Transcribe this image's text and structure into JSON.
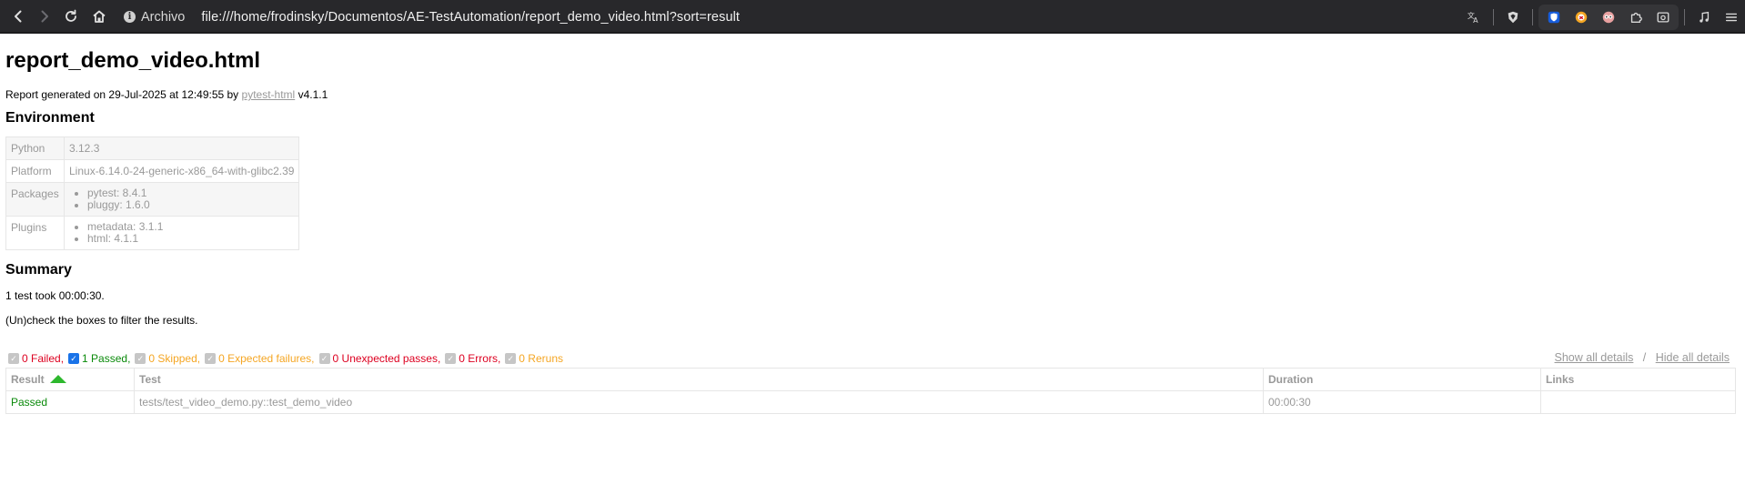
{
  "browser": {
    "site_label": "Archivo",
    "url": "file:///home/frodinsky/Documentos/AE-TestAutomation/report_demo_video.html?sort=result"
  },
  "report": {
    "title": "report_demo_video.html",
    "generated_prefix": "Report generated on 29-Jul-2025 at 12:49:55 by",
    "generator_link": "pytest-html",
    "generator_version": "v4.1.1"
  },
  "environment": {
    "heading": "Environment",
    "rows": [
      {
        "key": "Python",
        "value": "3.12.3"
      },
      {
        "key": "Platform",
        "value": "Linux-6.14.0-24-generic-x86_64-with-glibc2.39"
      },
      {
        "key": "Packages",
        "items": [
          "pytest: 8.4.1",
          "pluggy: 1.6.0"
        ]
      },
      {
        "key": "Plugins",
        "items": [
          "metadata: 3.1.1",
          "html: 4.1.1"
        ]
      }
    ]
  },
  "summary": {
    "heading": "Summary",
    "took": "1 test took 00:00:30.",
    "filter_hint": "(Un)check the boxes to filter the results.",
    "filters": {
      "failed": "0 Failed,",
      "passed": "1 Passed,",
      "skipped": "0 Skipped,",
      "xfailed": "0 Expected failures,",
      "xpassed": "0 Unexpected passes,",
      "errors": "0 Errors,",
      "reruns": "0 Reruns"
    },
    "show_all": "Show all details",
    "divider": "/",
    "hide_all": "Hide all details"
  },
  "results": {
    "columns": [
      "Result",
      "Test",
      "Duration",
      "Links"
    ],
    "rows": [
      {
        "result": "Passed",
        "test": "tests/test_video_demo.py::test_demo_video",
        "duration": "00:00:30",
        "links": ""
      }
    ]
  },
  "colors": {
    "failed": "#dd0020",
    "passed": "#0a8a0a",
    "other": "#f5a623",
    "muted": "#999999"
  }
}
